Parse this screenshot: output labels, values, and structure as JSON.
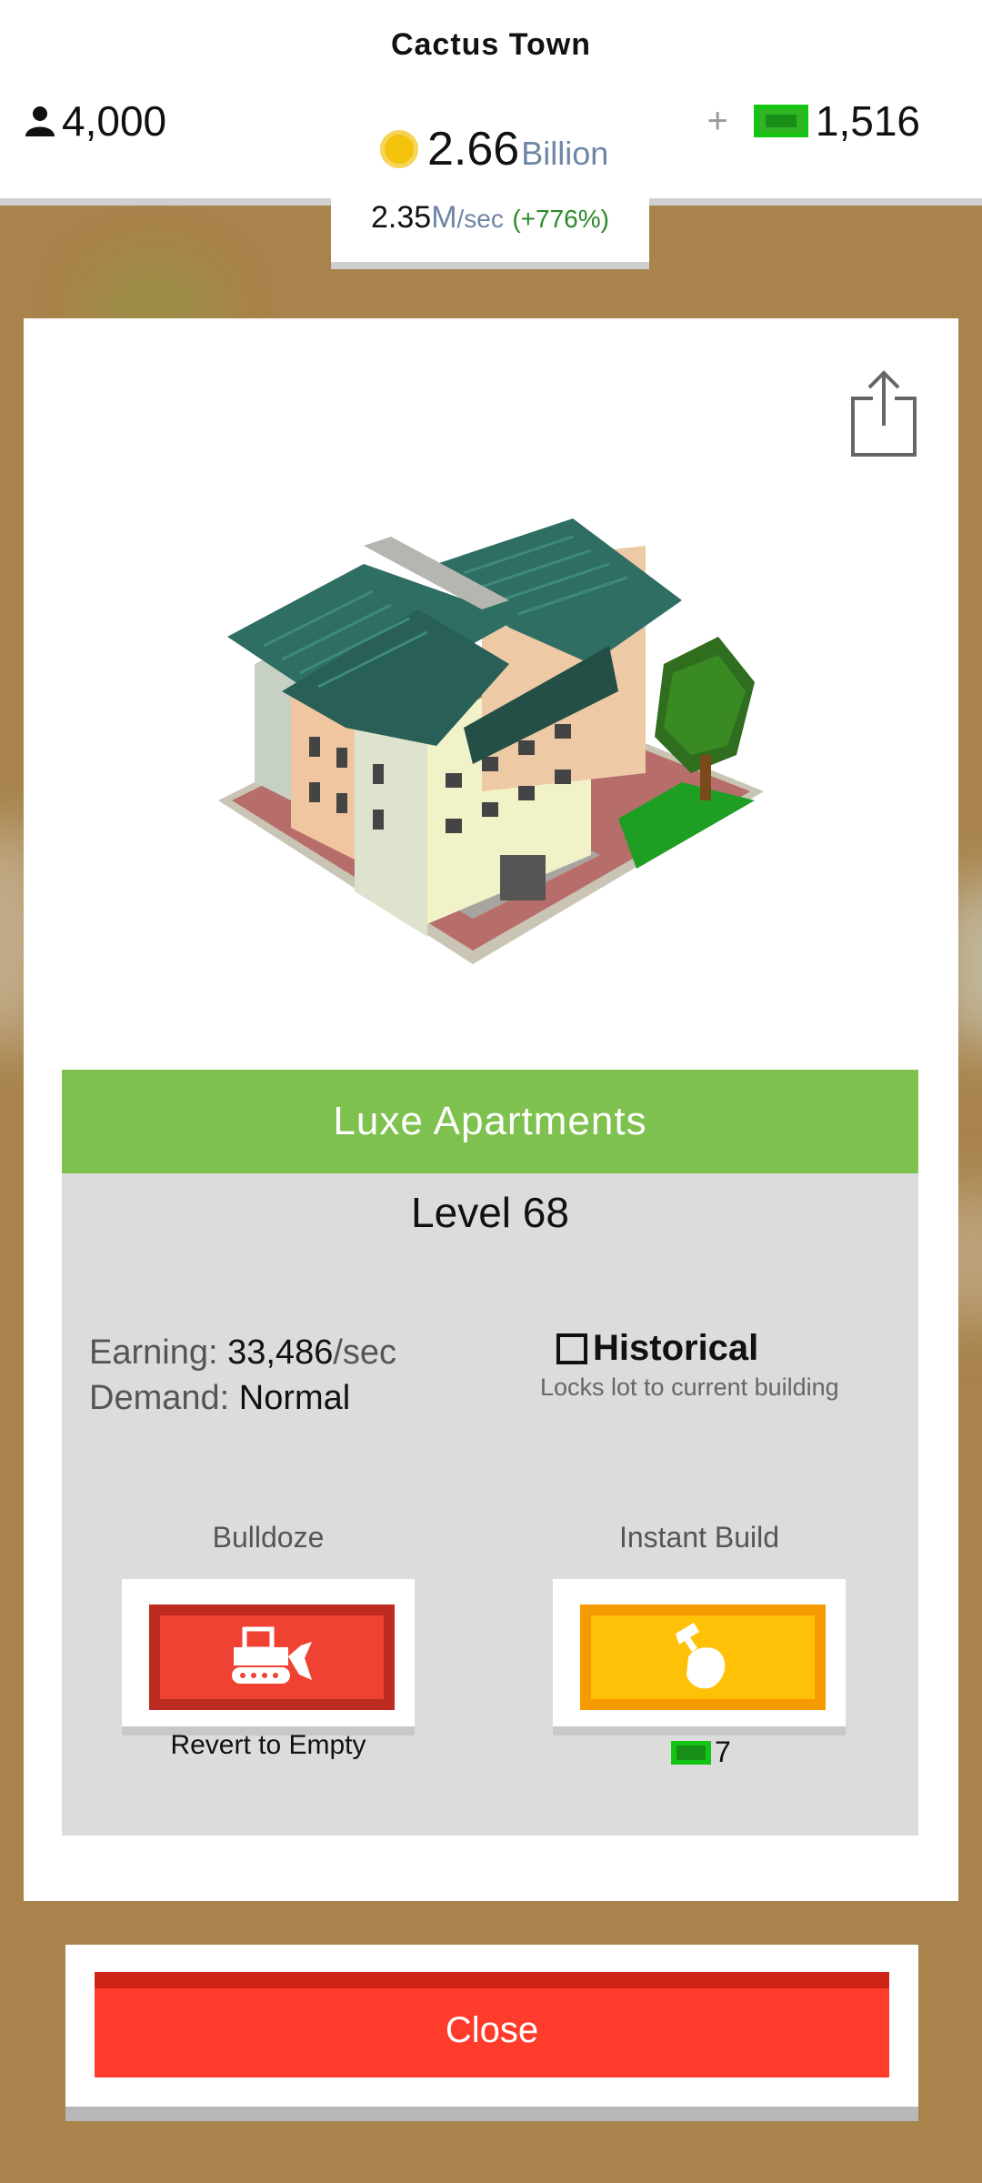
{
  "header": {
    "town_name": "Cactus Town",
    "population": "4,000",
    "coins_value": "2.66",
    "coins_unit": "Billion",
    "bucks": "1,516",
    "plus_label": "+",
    "rate_value": "2.35",
    "rate_unit": "M",
    "rate_per": "/sec",
    "rate_change": "(+776%)"
  },
  "building": {
    "name": "Luxe Apartments",
    "level": "Level 68",
    "earning_label": "Earning:",
    "earning_value": "33,486",
    "earning_unit": "/sec",
    "demand_label": "Demand:",
    "demand_value": "Normal",
    "historical_label": "Historical",
    "historical_sub": "Locks lot to current building",
    "historical_checked": false
  },
  "actions": {
    "bulldoze_label": "Bulldoze",
    "bulldoze_caption": "Revert to Empty",
    "instant_label": "Instant Build",
    "instant_cost": "7"
  },
  "close_label": "Close",
  "icons": {
    "population": "person-icon",
    "coins": "coin-icon",
    "bucks": "bill-icon",
    "share": "share-icon",
    "bulldoze": "bulldozer-icon",
    "instant": "hammer-hand-icon",
    "checkbox": "checkbox-icon"
  },
  "colors": {
    "title_bar": "#7ec14e",
    "bulldoze_button": "#ef4232",
    "instant_button": "#ffc107",
    "close_button": "#ff3b2c",
    "rate_change": "#2a8a2a",
    "accent_text": "#6e86a6"
  }
}
